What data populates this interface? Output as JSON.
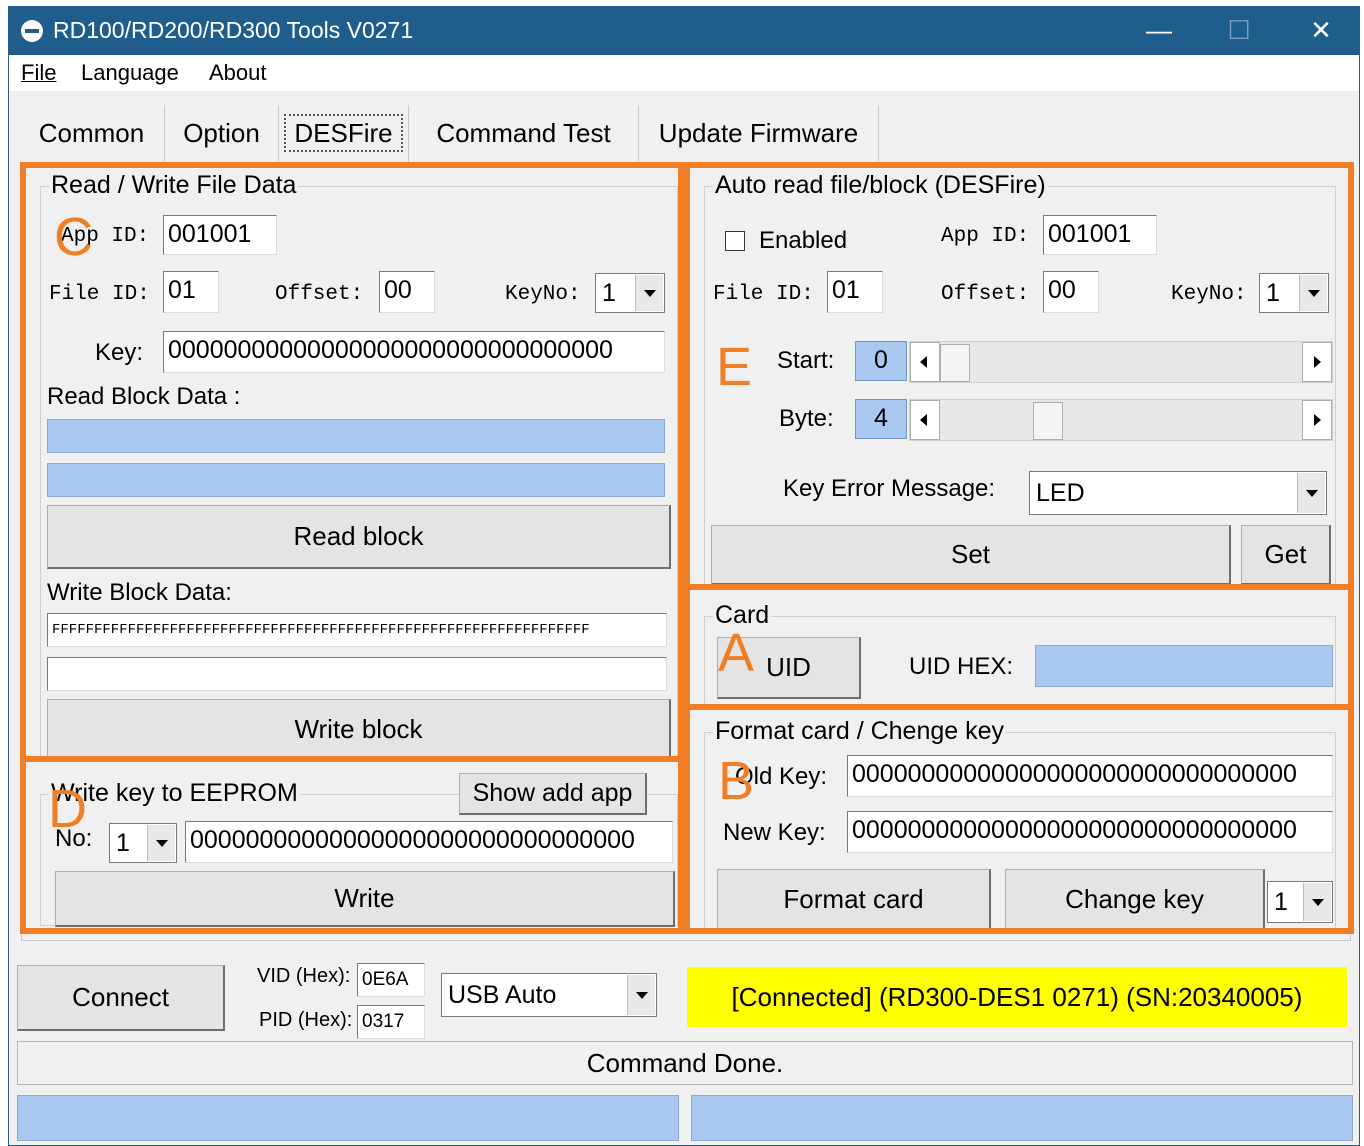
{
  "window": {
    "title": "RD100/RD200/RD300 Tools V0271"
  },
  "menu": {
    "file": "File",
    "language": "Language",
    "about": "About"
  },
  "tabs": [
    "Common",
    "Option",
    "DESFire",
    "Command Test",
    "Update Firmware"
  ],
  "rw": {
    "group_title": "Read / Write File Data",
    "app_id_label": "App ID:",
    "app_id": "001001",
    "file_id_label": "File ID:",
    "file_id": "01",
    "offset_label": "Offset:",
    "offset": "00",
    "keyno_label": "KeyNo:",
    "keyno": "1",
    "key_label": "Key:",
    "key": "00000000000000000000000000000000",
    "read_block_label": "Read Block Data :",
    "read_block_btn": "Read block",
    "write_block_label": "Write Block Data:",
    "write_data": "FFFFFFFFFFFFFFFFFFFFFFFFFFFFFFFFFFFFFFFFFFFFFFFFFFFFFFFFFFFFFFFF",
    "write_block_btn": "Write block"
  },
  "eeprom": {
    "group_title": "Write key to EEPROM",
    "show_add_app": "Show add app",
    "no_label": "No:",
    "no_value": "1",
    "key": "00000000000000000000000000000000",
    "write_btn": "Write"
  },
  "auto": {
    "group_title": "Auto read file/block (DESFire)",
    "enabled_label": "Enabled",
    "app_id_label": "App ID:",
    "app_id": "001001",
    "file_id_label": "File ID:",
    "file_id": "01",
    "offset_label": "Offset:",
    "offset": "00",
    "keyno_label": "KeyNo:",
    "keyno": "1",
    "start_label": "Start:",
    "start_value": "0",
    "start_fraction": 0.0,
    "byte_label": "Byte:",
    "byte_value": "4",
    "byte_fraction": 0.28,
    "key_error_label": "Key Error Message:",
    "key_error_value": "LED",
    "set_btn": "Set",
    "get_btn": "Get"
  },
  "card": {
    "group_title": "Card",
    "uid_btn": "UID",
    "uid_hex_label": "UID HEX:"
  },
  "format": {
    "group_title": "Format card / Chenge key",
    "old_key_label": "Old Key:",
    "old_key": "00000000000000000000000000000000",
    "new_key_label": "New Key:",
    "new_key": "00000000000000000000000000000000",
    "format_btn": "Format card",
    "change_btn": "Change key",
    "key_no": "1"
  },
  "annotations": [
    "C",
    "D",
    "E",
    "A",
    "B"
  ],
  "bottom": {
    "connect_btn": "Connect",
    "vid_label": "VID (Hex):",
    "vid": "0E6A",
    "pid_label": "PID (Hex):",
    "pid": "0317",
    "usb_mode": "USB Auto",
    "connection_status": "[Connected] (RD300-DES1  0271) (SN:20340005)",
    "command_status": "Command Done."
  },
  "colors": {
    "title_bar": "#1e5d8c",
    "highlight": "#f07e26",
    "status_yellow": "#ffff00",
    "field_blue": "#a8c8f0"
  }
}
